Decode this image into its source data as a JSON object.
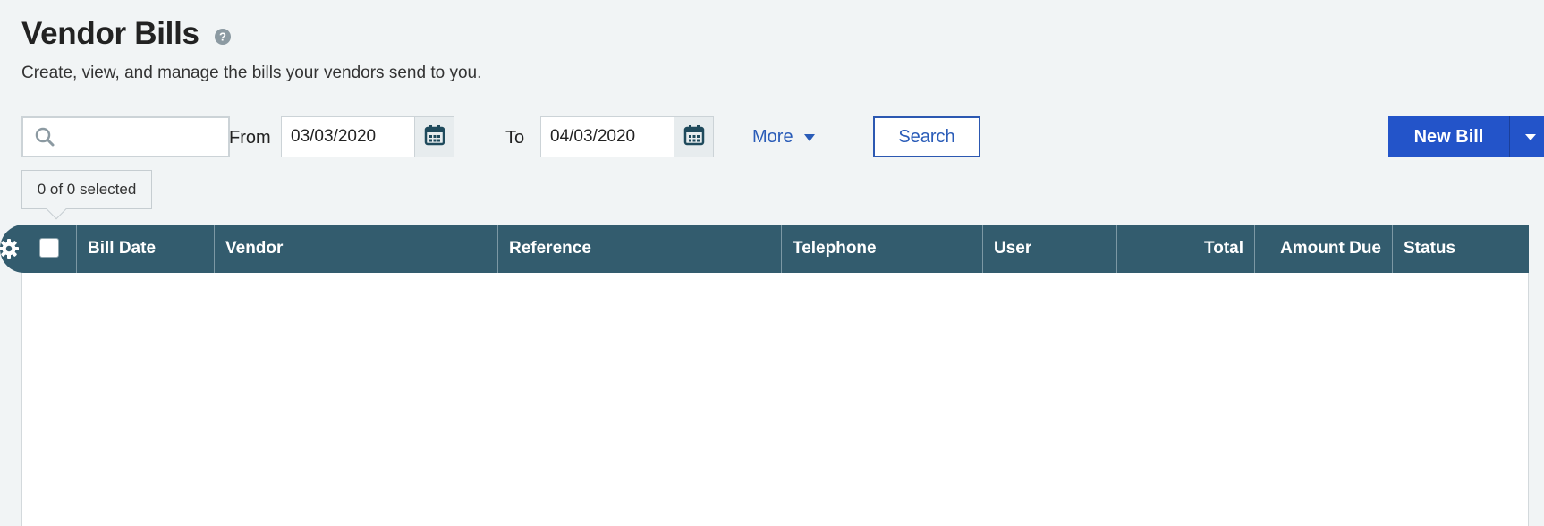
{
  "page": {
    "title": "Vendor Bills",
    "subtitle": "Create, view, and manage the bills your vendors send to you."
  },
  "icons": {
    "help": "help-circle-icon",
    "search": "search-icon",
    "calendar": "calendar-icon",
    "gear": "gear-icon",
    "caret": "caret-down-icon"
  },
  "toolbar": {
    "search_value": "",
    "from_label": "From",
    "from_date": "03/03/2020",
    "to_label": "To",
    "to_date": "04/03/2020",
    "more_label": "More",
    "search_label": "Search",
    "new_bill_label": "New Bill"
  },
  "selection": {
    "text": "0 of 0 selected"
  },
  "table": {
    "columns": [
      {
        "label": "Bill Date"
      },
      {
        "label": "Vendor"
      },
      {
        "label": "Reference"
      },
      {
        "label": "Telephone"
      },
      {
        "label": "User"
      },
      {
        "label": "Total"
      },
      {
        "label": "Amount Due"
      },
      {
        "label": "Status"
      }
    ],
    "rows": []
  },
  "colors": {
    "header_bg": "#335c6e",
    "primary_button": "#2354c9",
    "link": "#2a5cb8",
    "page_bg": "#f1f4f5"
  }
}
